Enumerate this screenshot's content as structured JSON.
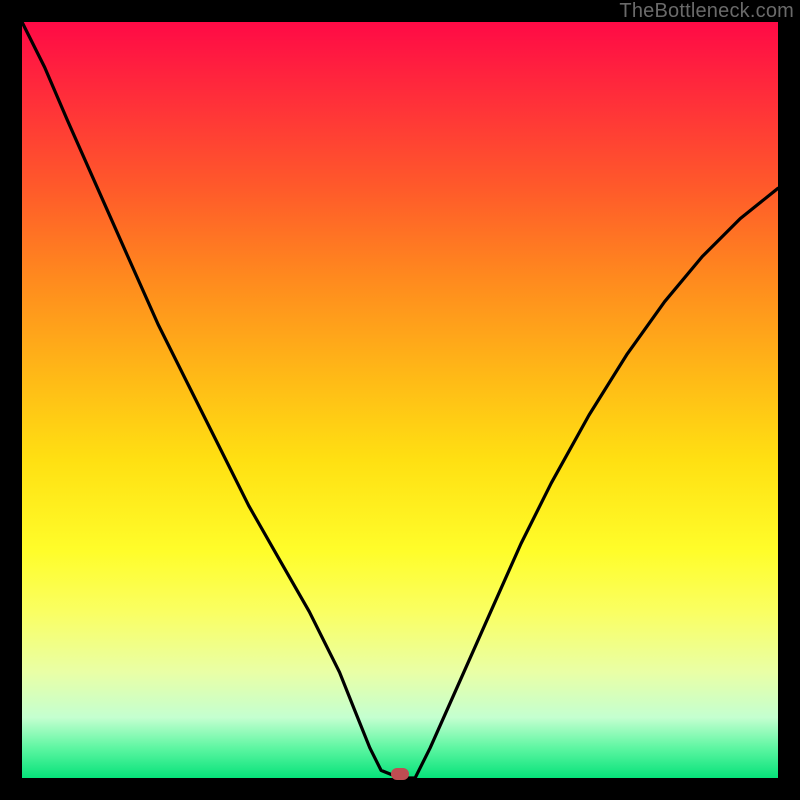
{
  "watermark": "TheBottleneck.com",
  "colors": {
    "frame": "#000000",
    "curve": "#000000",
    "marker": "#bf4d52",
    "gradient_top": "#ff0a46",
    "gradient_bottom": "#06e27a"
  },
  "chart_data": {
    "type": "line",
    "title": "",
    "xlabel": "",
    "ylabel": "",
    "xlim": [
      0,
      100
    ],
    "ylim": [
      0,
      100
    ],
    "series": [
      {
        "name": "bottleneck-curve",
        "x": [
          0,
          3,
          6,
          10,
          14,
          18,
          22,
          26,
          30,
          34,
          38,
          42,
          44,
          46,
          47.5,
          50,
          52,
          54,
          58,
          62,
          66,
          70,
          75,
          80,
          85,
          90,
          95,
          100
        ],
        "values": [
          100,
          94,
          87,
          78,
          69,
          60,
          52,
          44,
          36,
          29,
          22,
          14,
          9,
          4,
          1,
          0,
          0,
          4,
          13,
          22,
          31,
          39,
          48,
          56,
          63,
          69,
          74,
          78
        ]
      }
    ],
    "marker": {
      "x": 50,
      "y": 0,
      "label": "optimal-point"
    }
  }
}
